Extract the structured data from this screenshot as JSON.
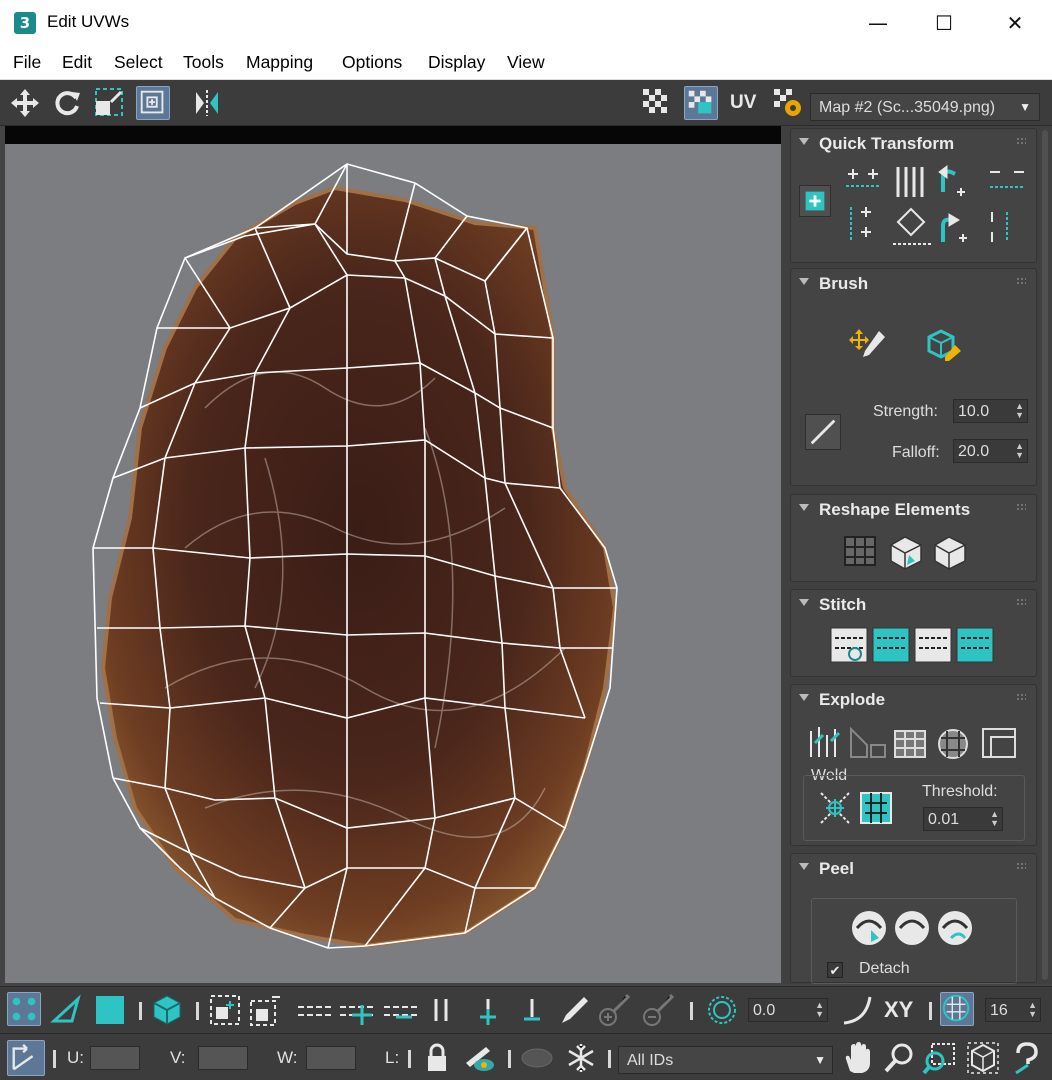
{
  "window": {
    "app_icon_text": "3",
    "title": "Edit UVWs",
    "minimize": "—",
    "maximize": "☐",
    "close": "✕"
  },
  "menu": [
    "File",
    "Edit",
    "Select",
    "Tools",
    "Mapping",
    "Options",
    "Display",
    "View"
  ],
  "toolbar": {
    "uv_label": "UV",
    "map_select": "Map #2 (Sc...35049.png)"
  },
  "panel": {
    "quick_transform": {
      "title": "Quick Transform"
    },
    "brush": {
      "title": "Brush",
      "strength_label": "Strength:",
      "strength_value": "10.0",
      "falloff_label": "Falloff:",
      "falloff_value": "20.0"
    },
    "reshape": {
      "title": "Reshape Elements"
    },
    "stitch": {
      "title": "Stitch"
    },
    "explode": {
      "title": "Explode",
      "weld_label": "Weld",
      "threshold_label": "Threshold:",
      "threshold_value": "0.01"
    },
    "peel": {
      "title": "Peel",
      "detach_label": "Detach"
    }
  },
  "bottom1": {
    "angle_value": "0.0",
    "xy_label": "XY",
    "grid_value": "16"
  },
  "bottom2": {
    "u_label": "U:",
    "v_label": "V:",
    "w_label": "W:",
    "l_label": "L:",
    "id_select": "All IDs"
  },
  "colors": {
    "accent": "#2ec4c4",
    "viewport_bg": "#7b7d80",
    "ui_dark": "#3c3c3c",
    "active_button": "#5d7897"
  }
}
